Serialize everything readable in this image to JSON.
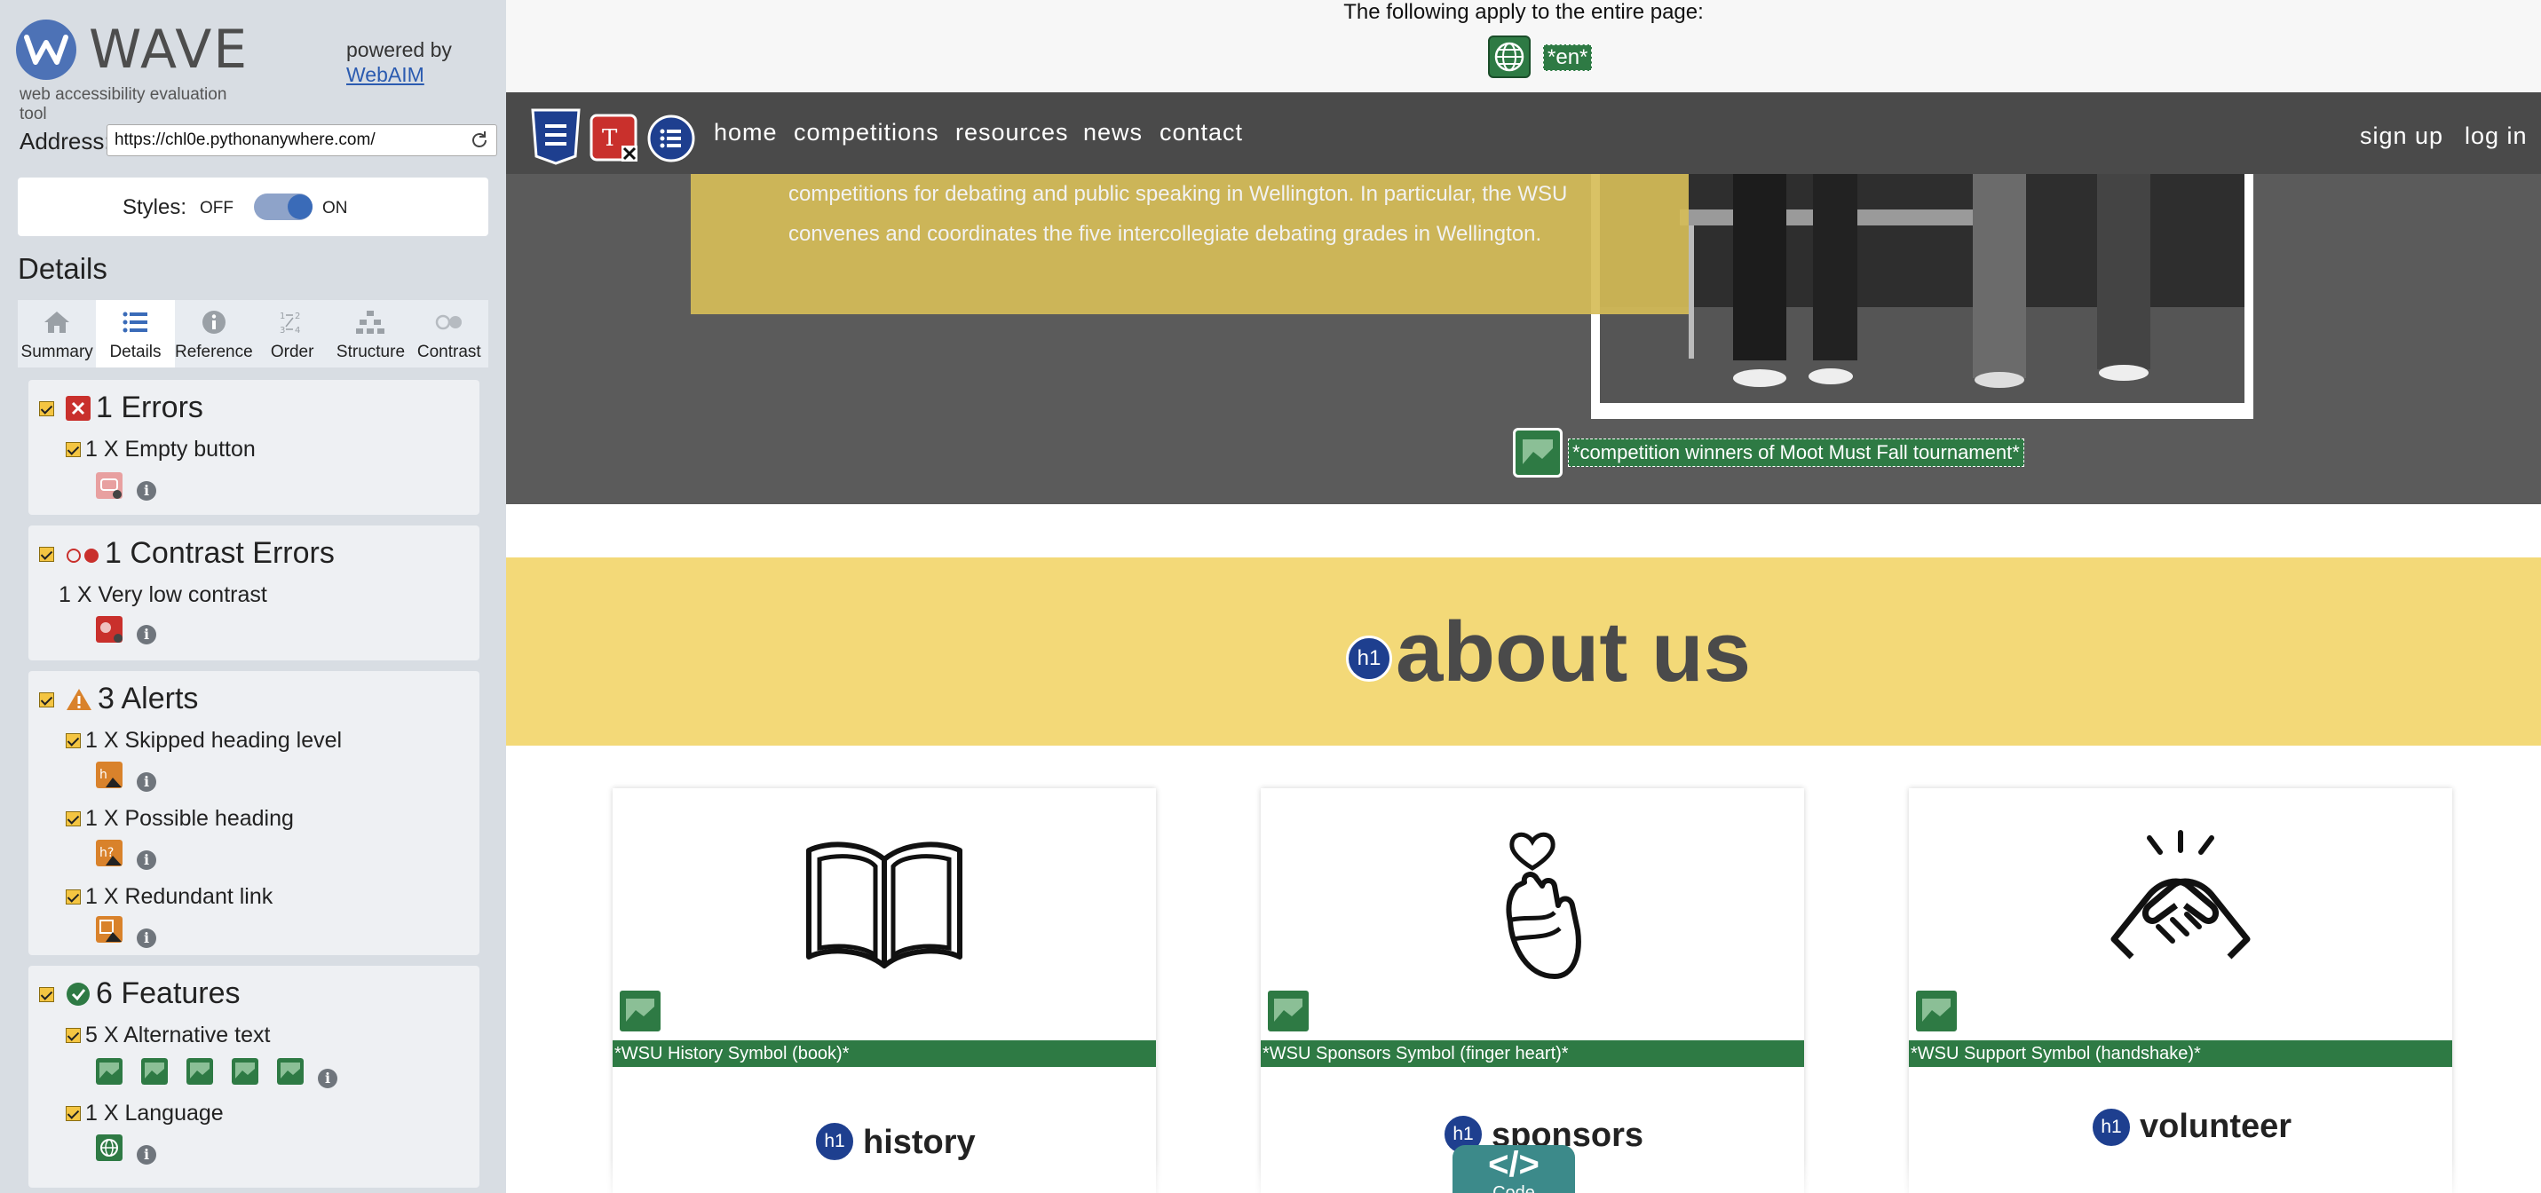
{
  "wave": {
    "logo": "WAVE",
    "subtitle": "web accessibility evaluation tool",
    "powered_by": "powered by",
    "webaim_link": "WebAIM",
    "address_label": "Address:",
    "address_value": "https://chl0e.pythonanywhere.com/",
    "styles_label": "Styles:",
    "styles_off": "OFF",
    "styles_on": "ON",
    "styles_enabled": true,
    "details_heading": "Details",
    "tabs": [
      {
        "label": "Summary",
        "icon": "home-icon"
      },
      {
        "label": "Details",
        "icon": "list-icon",
        "active": true
      },
      {
        "label": "Reference",
        "icon": "info-icon"
      },
      {
        "label": "Order",
        "icon": "order-icon"
      },
      {
        "label": "Structure",
        "icon": "structure-icon"
      },
      {
        "label": "Contrast",
        "icon": "contrast-icon"
      }
    ],
    "sections": {
      "errors": {
        "title": "1 Errors",
        "items": [
          {
            "label": "1 X Empty button"
          }
        ]
      },
      "contrast": {
        "title": "1 Contrast Errors",
        "items": [
          {
            "label": "1 X Very low contrast"
          }
        ]
      },
      "alerts": {
        "title": "3 Alerts",
        "items": [
          {
            "label": "1 X Skipped heading level"
          },
          {
            "label": "1 X Possible heading"
          },
          {
            "label": "1 X Redundant link"
          }
        ]
      },
      "features": {
        "title": "6 Features",
        "items": [
          {
            "label": "5 X Alternative text"
          },
          {
            "label": "1 X Language"
          }
        ]
      }
    },
    "colors": {
      "error": "#c9302c",
      "alert": "#d9822b",
      "feature": "#2e7a44",
      "brand": "#4d72b6"
    }
  },
  "page": {
    "applies_text": "The following apply to the entire page:",
    "lang_tag": "*en*",
    "nav": {
      "links": [
        "home",
        "competitions",
        "resources",
        "news",
        "contact"
      ],
      "right_links": [
        "sign up",
        "log in"
      ]
    },
    "hero": {
      "line1": "competitions for debating and public speaking in Wellington. In particular, the WSU",
      "line2": "convenes and coordinates the five intercollegiate debating grades in Wellington.",
      "image_alt": "*competition winners of Moot Must Fall tournament*"
    },
    "about": {
      "h1_badge": "h1",
      "heading": "about us"
    },
    "cards": [
      {
        "alt": "*WSU History Symbol (book)*",
        "h1_badge": "h1",
        "title": "history"
      },
      {
        "alt": "*WSU Sponsors Symbol (finger heart)*",
        "h1_badge": "h1",
        "title": "sponsors"
      },
      {
        "alt": "*WSU Support Symbol (handshake)*",
        "h1_badge": "h1",
        "title": "volunteer"
      }
    ],
    "code_button": {
      "symbol": "</>",
      "label": "Code"
    }
  }
}
